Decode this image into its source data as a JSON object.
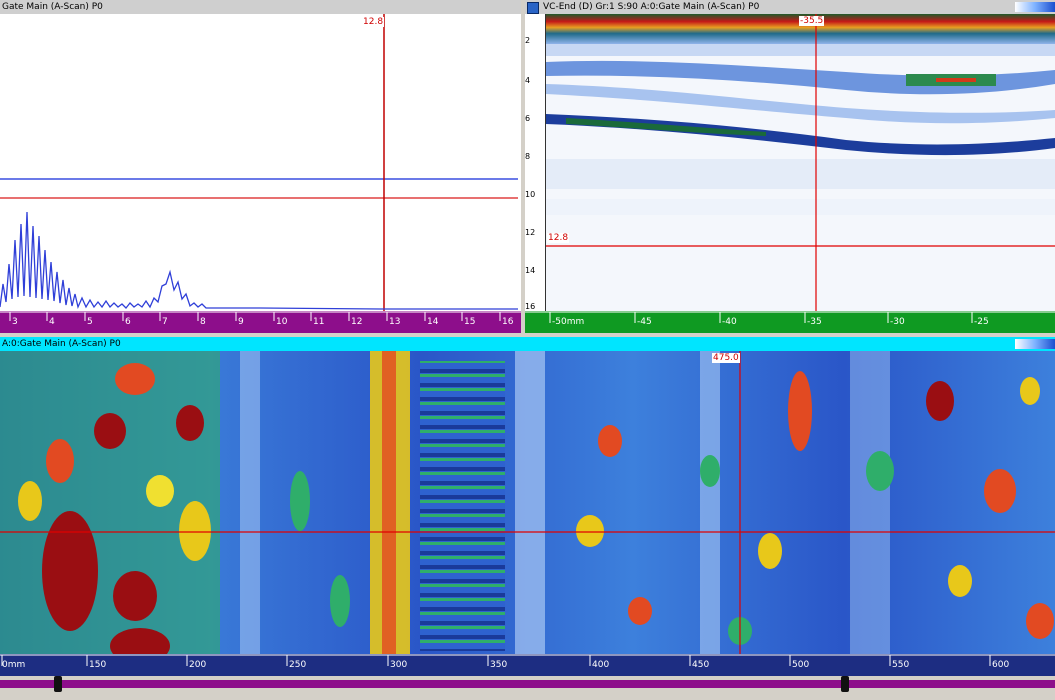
{
  "ascan": {
    "title": "Gate Main (A-Scan) P0",
    "cursor_label": "12.8",
    "ruler_ticks": [
      "3",
      "4",
      "5",
      "6",
      "7",
      "8",
      "9",
      "10",
      "11",
      "12",
      "13",
      "14",
      "15",
      "16"
    ]
  },
  "bscan": {
    "title": "VC-End (D) Gr:1 S:90 A:0:Gate Main (A-Scan) P0",
    "cursor_top_label": "-35.5",
    "cursor_side_label": "12.8",
    "depth_ticks": [
      "2",
      "4",
      "6",
      "8",
      "10",
      "12",
      "14",
      "16"
    ],
    "ruler_ticks": [
      "-50mm",
      "-45",
      "-40",
      "-35",
      "-30",
      "-25"
    ]
  },
  "cscan": {
    "title": "A:0:Gate Main (A-Scan) P0",
    "cursor_label": "475.0",
    "ruler_ticks": [
      "0mm",
      "150",
      "200",
      "250",
      "300",
      "350",
      "400",
      "450",
      "500",
      "550",
      "600"
    ]
  },
  "colors": {
    "cursor": "#e00000",
    "gate_blue": "#3a4fe0",
    "signal": "#2f3fd8"
  }
}
